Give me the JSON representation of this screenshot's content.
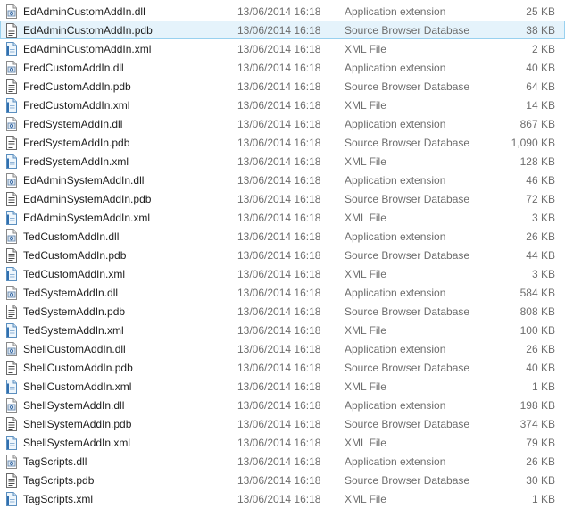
{
  "colors": {
    "selected_bg": "#e5f3fb",
    "selected_border": "#99d1ef",
    "meta_text": "#6d6d6d"
  },
  "files": [
    {
      "name": "EdAdminCustomAddIn.dll",
      "date": "13/06/2014 16:18",
      "type": "Application extension",
      "size": "25 KB",
      "icon": "dll-file-icon"
    },
    {
      "name": "EdAdminCustomAddIn.pdb",
      "date": "13/06/2014 16:18",
      "type": "Source Browser Database",
      "size": "38 KB",
      "icon": "pdb-file-icon",
      "selected": true
    },
    {
      "name": "EdAdminCustomAddIn.xml",
      "date": "13/06/2014 16:18",
      "type": "XML File",
      "size": "2 KB",
      "icon": "xml-file-icon"
    },
    {
      "name": "FredCustomAddIn.dll",
      "date": "13/06/2014 16:18",
      "type": "Application extension",
      "size": "40 KB",
      "icon": "dll-file-icon"
    },
    {
      "name": "FredCustomAddIn.pdb",
      "date": "13/06/2014 16:18",
      "type": "Source Browser Database",
      "size": "64 KB",
      "icon": "pdb-file-icon"
    },
    {
      "name": "FredCustomAddIn.xml",
      "date": "13/06/2014 16:18",
      "type": "XML File",
      "size": "14 KB",
      "icon": "xml-file-icon"
    },
    {
      "name": "FredSystemAddIn.dll",
      "date": "13/06/2014 16:18",
      "type": "Application extension",
      "size": "867 KB",
      "icon": "dll-file-icon"
    },
    {
      "name": "FredSystemAddIn.pdb",
      "date": "13/06/2014 16:18",
      "type": "Source Browser Database",
      "size": "1,090 KB",
      "icon": "pdb-file-icon"
    },
    {
      "name": "FredSystemAddIn.xml",
      "date": "13/06/2014 16:18",
      "type": "XML File",
      "size": "128 KB",
      "icon": "xml-file-icon"
    },
    {
      "name": "EdAdminSystemAddIn.dll",
      "date": "13/06/2014 16:18",
      "type": "Application extension",
      "size": "46 KB",
      "icon": "dll-file-icon"
    },
    {
      "name": "EdAdminSystemAddIn.pdb",
      "date": "13/06/2014 16:18",
      "type": "Source Browser Database",
      "size": "72 KB",
      "icon": "pdb-file-icon"
    },
    {
      "name": "EdAdminSystemAddIn.xml",
      "date": "13/06/2014 16:18",
      "type": "XML File",
      "size": "3 KB",
      "icon": "xml-file-icon"
    },
    {
      "name": "TedCustomAddIn.dll",
      "date": "13/06/2014 16:18",
      "type": "Application extension",
      "size": "26 KB",
      "icon": "dll-file-icon"
    },
    {
      "name": "TedCustomAddIn.pdb",
      "date": "13/06/2014 16:18",
      "type": "Source Browser Database",
      "size": "44 KB",
      "icon": "pdb-file-icon"
    },
    {
      "name": "TedCustomAddIn.xml",
      "date": "13/06/2014 16:18",
      "type": "XML File",
      "size": "3 KB",
      "icon": "xml-file-icon"
    },
    {
      "name": "TedSystemAddIn.dll",
      "date": "13/06/2014 16:18",
      "type": "Application extension",
      "size": "584 KB",
      "icon": "dll-file-icon"
    },
    {
      "name": "TedSystemAddIn.pdb",
      "date": "13/06/2014 16:18",
      "type": "Source Browser Database",
      "size": "808 KB",
      "icon": "pdb-file-icon"
    },
    {
      "name": "TedSystemAddIn.xml",
      "date": "13/06/2014 16:18",
      "type": "XML File",
      "size": "100 KB",
      "icon": "xml-file-icon"
    },
    {
      "name": "ShellCustomAddIn.dll",
      "date": "13/06/2014 16:18",
      "type": "Application extension",
      "size": "26 KB",
      "icon": "dll-file-icon"
    },
    {
      "name": "ShellCustomAddIn.pdb",
      "date": "13/06/2014 16:18",
      "type": "Source Browser Database",
      "size": "40 KB",
      "icon": "pdb-file-icon"
    },
    {
      "name": "ShellCustomAddIn.xml",
      "date": "13/06/2014 16:18",
      "type": "XML File",
      "size": "1 KB",
      "icon": "xml-file-icon"
    },
    {
      "name": "ShellSystemAddIn.dll",
      "date": "13/06/2014 16:18",
      "type": "Application extension",
      "size": "198 KB",
      "icon": "dll-file-icon"
    },
    {
      "name": "ShellSystemAddIn.pdb",
      "date": "13/06/2014 16:18",
      "type": "Source Browser Database",
      "size": "374 KB",
      "icon": "pdb-file-icon"
    },
    {
      "name": "ShellSystemAddIn.xml",
      "date": "13/06/2014 16:18",
      "type": "XML File",
      "size": "79 KB",
      "icon": "xml-file-icon"
    },
    {
      "name": "TagScripts.dll",
      "date": "13/06/2014 16:18",
      "type": "Application extension",
      "size": "26 KB",
      "icon": "dll-file-icon"
    },
    {
      "name": "TagScripts.pdb",
      "date": "13/06/2014 16:18",
      "type": "Source Browser Database",
      "size": "30 KB",
      "icon": "pdb-file-icon"
    },
    {
      "name": "TagScripts.xml",
      "date": "13/06/2014 16:18",
      "type": "XML File",
      "size": "1 KB",
      "icon": "xml-file-icon"
    }
  ]
}
